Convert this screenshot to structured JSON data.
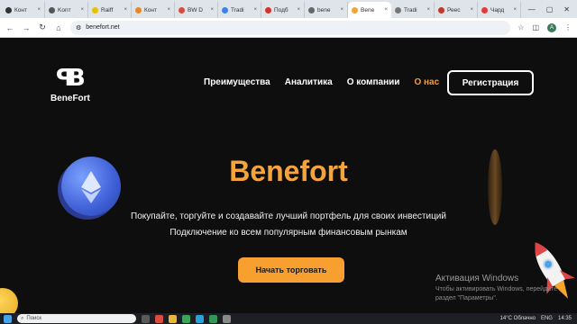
{
  "tabs": [
    {
      "label": "Конт",
      "color": "#333333"
    },
    {
      "label": "Konт",
      "color": "#555555"
    },
    {
      "label": "Raiff",
      "color": "#e6c200"
    },
    {
      "label": "Конт",
      "color": "#e28a2b"
    },
    {
      "label": "BW D",
      "color": "#d94c3f"
    },
    {
      "label": "Tradi",
      "color": "#3a82e4"
    },
    {
      "label": "Подб",
      "color": "#d0342c"
    },
    {
      "label": "bene",
      "color": "#666666"
    },
    {
      "label": "Bene",
      "color": "#f5a43c",
      "active": true
    },
    {
      "label": "Tradi",
      "color": "#777777"
    },
    {
      "label": "Реес",
      "color": "#c0392b"
    },
    {
      "label": "Чард",
      "color": "#e03c3c"
    }
  ],
  "window_controls": {
    "minimize": "—",
    "maximize": "▢",
    "close": "✕"
  },
  "toolbar": {
    "back": "←",
    "forward": "→",
    "reload": "↻",
    "home": "⌂",
    "url": "benefort.net",
    "profile": "A"
  },
  "site": {
    "logo_mark": "ꟼB",
    "logo_text": "BeneFort",
    "nav": [
      "Преимущества",
      "Аналитика",
      "О компании",
      "О нас"
    ],
    "register": "Регистрация",
    "title": "Benefort",
    "subtitle1": "Покупайте, торгуйте и создавайте лучший портфель для своих инвестиций",
    "subtitle2": "Подключение ко всем популярным финансовым рынкам",
    "cta": "Начать торговать"
  },
  "watermark": {
    "title": "Активация Windows",
    "line1": "Чтобы активировать Windows, перейдите",
    "line2": "раздел \"Параметры\"."
  },
  "taskbar": {
    "search_placeholder": "Поиск",
    "weather": "14°C Облачно",
    "lang": "ENG",
    "time": "14:35"
  },
  "colors": {
    "accent": "#f79f2f",
    "title": "#f5a43c",
    "background": "#0e0e0e"
  }
}
